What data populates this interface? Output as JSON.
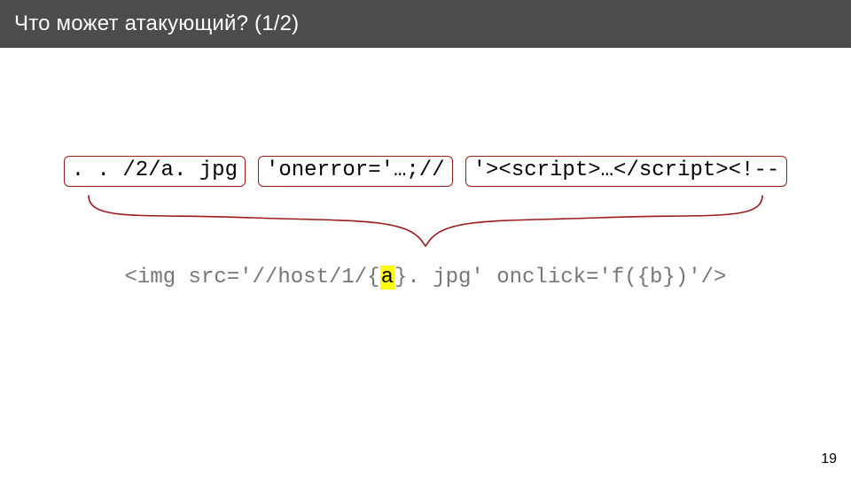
{
  "title": "Что может атакующий? (1/2)",
  "payloads": {
    "p1": ". . /2/a. jpg",
    "p2": "'onerror='…;//",
    "p3": "'><script>…</script><!--"
  },
  "template": {
    "pre": "<img src='//host/1/{",
    "hl": "a",
    "post": "}. jpg' onclick='f({b})'/>"
  },
  "page_number": "19"
}
